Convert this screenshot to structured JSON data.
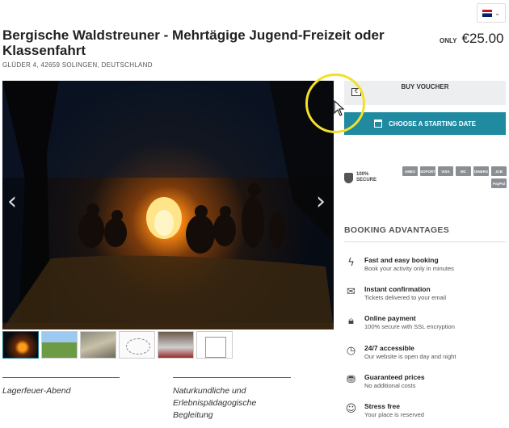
{
  "header": {
    "title": "Bergische Waldstreuner - Mehrtägige Jugend-Freizeit oder Klassenfahrt",
    "address": "GLÜDER 4, 42659 SOLINGEN, DEUTSCHLAND",
    "price_prefix": "ONLY",
    "price": "€25.00"
  },
  "gallery": {
    "main_image": "campfire-night-photo",
    "thumbnails": [
      "campfire",
      "meadow",
      "rock-wall",
      "sketch-diagram",
      "group-photo",
      "worksheet"
    ]
  },
  "tabs": [
    {
      "label": "Lagerfeuer-Abend"
    },
    {
      "label": "Naturkundliche und Erlebnispädagogische Begleitung"
    }
  ],
  "booking": {
    "voucher_label": "BUY VOUCHER",
    "voucher_icon_text": "€",
    "date_label": "CHOOSE A STARTING DATE",
    "ssl_line1": "100%",
    "ssl_line2": "SECURE",
    "payments": [
      "AMEX",
      "SOFORT",
      "VISA",
      "MC",
      "DINERS",
      "JCB",
      "PayPal"
    ]
  },
  "advantages": {
    "heading": "BOOKING ADVANTAGES",
    "items": [
      {
        "icon": "lightning-icon",
        "title": "Fast and easy booking",
        "desc": "Book your activity only in minutes"
      },
      {
        "icon": "envelope-icon",
        "title": "Instant confirmation",
        "desc": "Tickets delivered to your email"
      },
      {
        "icon": "lock-icon",
        "title": "Online payment",
        "desc": "100% secure with SSL encryption"
      },
      {
        "icon": "clock-icon",
        "title": "24/7 accessible",
        "desc": "Our website is open day and night"
      },
      {
        "icon": "coins-icon",
        "title": "Guaranteed prices",
        "desc": "No additional costs"
      },
      {
        "icon": "smiley-icon",
        "title": "Stress free",
        "desc": "Your place is reserved"
      }
    ]
  },
  "colors": {
    "accent": "#1f8aa0",
    "highlight": "#f2e12a"
  }
}
